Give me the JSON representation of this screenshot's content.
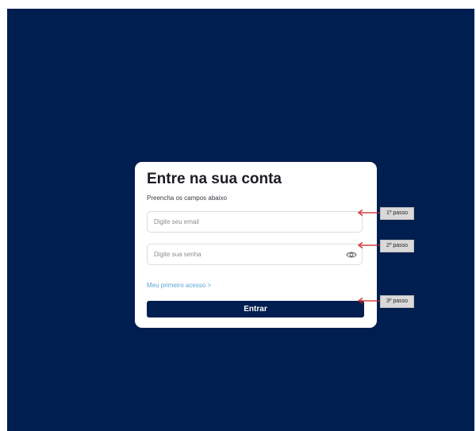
{
  "login": {
    "title": "Entre na sua conta",
    "subtitle": "Preencha os campos abaixo",
    "email_placeholder": "Digite seu email",
    "password_placeholder": "Digite sua senha",
    "first_access_link": "Meu primeiro acesso >",
    "submit_label": "Entrar",
    "password_toggle_icon": "eye-icon"
  },
  "annotations": [
    {
      "label": "1º passo",
      "arrow_color": "#cc1f1f"
    },
    {
      "label": "2º passo",
      "arrow_color": "#cc1f1f"
    },
    {
      "label": "3º passo",
      "arrow_color": "#cc1f1f"
    }
  ],
  "colors": {
    "background": "#001e4f",
    "card": "#ffffff",
    "button": "#001e4f",
    "link": "#5aa7d6"
  }
}
